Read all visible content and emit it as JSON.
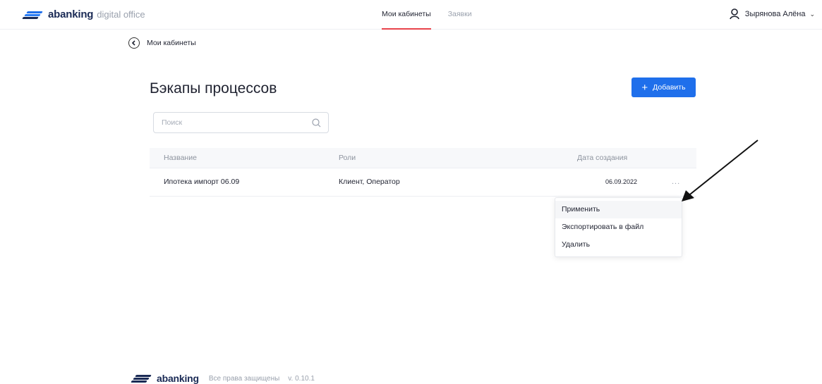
{
  "header": {
    "brand": "abanking",
    "brand_sub": "digital office",
    "tabs": [
      {
        "label": "Мои кабинеты",
        "active": true
      },
      {
        "label": "Заявки",
        "active": false
      }
    ],
    "user_name": "Зырянова Алёна"
  },
  "breadcrumb": {
    "label": "Мои кабинеты"
  },
  "page": {
    "title": "Бэкапы процессов",
    "add_label": "Добавить"
  },
  "search": {
    "placeholder": "Поиск",
    "value": ""
  },
  "table": {
    "columns": [
      "Название",
      "Роли",
      "Дата создания"
    ],
    "rows": [
      {
        "name": "Ипотека импорт 06.09",
        "roles": "Клиент, Оператор",
        "date": "06.09.2022",
        "more": "..."
      }
    ]
  },
  "menu": {
    "items": [
      "Применить",
      "Экспортировать в файл",
      "Удалить"
    ]
  },
  "footer": {
    "brand": "abanking",
    "rights": "Все права защищены",
    "version": "v. 0.10.1"
  },
  "colors": {
    "accent": "#1f6feb",
    "active_tab_underline": "#e8434b"
  }
}
